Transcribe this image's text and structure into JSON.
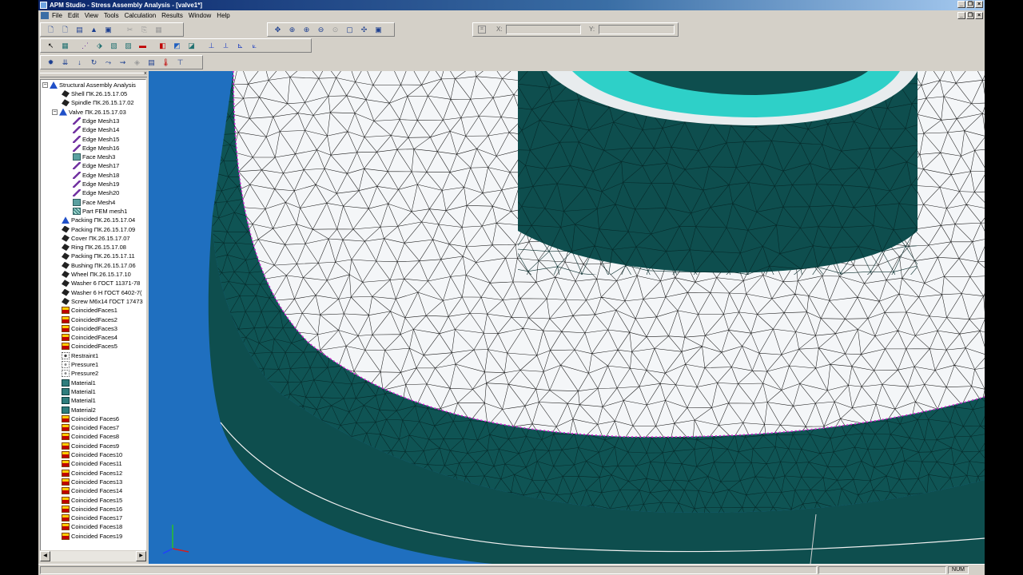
{
  "window": {
    "title": "APM Studio - Stress Assembly Analysis - [valve1*]"
  },
  "menu": {
    "items": [
      "File",
      "Edit",
      "View",
      "Tools",
      "Calculation",
      "Results",
      "Window",
      "Help"
    ]
  },
  "coords": {
    "x_label": "X:",
    "y_label": "Y:",
    "x_value": "",
    "y_value": ""
  },
  "tree": {
    "root": "Structural Assembly Analysis",
    "items": [
      {
        "label": "Shell ПК.26.15.17.05",
        "icon": "part-icon",
        "level": 1
      },
      {
        "label": "Spindle ПК.26.15.17.02",
        "icon": "part-icon",
        "level": 1
      },
      {
        "label": "Valve ПК.26.15.17.03",
        "icon": "assembly-icon",
        "level": 1,
        "expanded": true
      },
      {
        "label": "Edge Mesh13",
        "icon": "edge-mesh-icon",
        "level": 2
      },
      {
        "label": "Edge Mesh14",
        "icon": "edge-mesh-icon",
        "level": 2
      },
      {
        "label": "Edge Mesh15",
        "icon": "edge-mesh-icon",
        "level": 2
      },
      {
        "label": "Edge Mesh16",
        "icon": "edge-mesh-icon",
        "level": 2
      },
      {
        "label": "Face Mesh3",
        "icon": "face-mesh-icon",
        "level": 2
      },
      {
        "label": "Edge Mesh17",
        "icon": "edge-mesh-icon",
        "level": 2
      },
      {
        "label": "Edge Mesh18",
        "icon": "edge-mesh-icon",
        "level": 2
      },
      {
        "label": "Edge Mesh19",
        "icon": "edge-mesh-icon",
        "level": 2
      },
      {
        "label": "Edge Mesh20",
        "icon": "edge-mesh-icon",
        "level": 2
      },
      {
        "label": "Face Mesh4",
        "icon": "face-mesh-icon",
        "level": 2
      },
      {
        "label": "Part FEM mesh1",
        "icon": "fem-mesh-icon",
        "level": 2
      },
      {
        "label": "Packing ПК.26.15.17.04",
        "icon": "assembly-icon",
        "level": 1
      },
      {
        "label": "Packing ПК.26.15.17.09",
        "icon": "part-icon",
        "level": 1
      },
      {
        "label": "Cover ПК.26.15.17.07",
        "icon": "part-icon",
        "level": 1
      },
      {
        "label": "Ring ПК.26.15.17.08",
        "icon": "part-icon",
        "level": 1
      },
      {
        "label": "Packing ПК.26.15.17.11",
        "icon": "part-icon",
        "level": 1
      },
      {
        "label": "Bushing ПК.26.15.17.06",
        "icon": "part-icon",
        "level": 1
      },
      {
        "label": "Wheel ПК.26.15.17.10",
        "icon": "part-icon",
        "level": 1
      },
      {
        "label": "Washer 6 ГОСТ 11371-78",
        "icon": "part-icon",
        "level": 1
      },
      {
        "label": "Washer 6 Н ГОСТ 6402-7(",
        "icon": "part-icon",
        "level": 1
      },
      {
        "label": "Screw М6х14 ГОСТ 17473",
        "icon": "part-icon",
        "level": 1
      },
      {
        "label": "CoincidedFaces1",
        "icon": "coincided-faces-icon",
        "level": 1
      },
      {
        "label": "CoincidedFaces2",
        "icon": "coincided-faces-icon",
        "level": 1
      },
      {
        "label": "CoincidedFaces3",
        "icon": "coincided-faces-icon",
        "level": 1
      },
      {
        "label": "CoincidedFaces4",
        "icon": "coincided-faces-icon",
        "level": 1
      },
      {
        "label": "CoincidedFaces5",
        "icon": "coincided-faces-icon",
        "level": 1
      },
      {
        "label": "Restraint1",
        "icon": "restraint-icon",
        "level": 1
      },
      {
        "label": "Pressure1",
        "icon": "pressure-icon",
        "level": 1
      },
      {
        "label": "Pressure2",
        "icon": "pressure-icon",
        "level": 1
      },
      {
        "label": "Material1",
        "icon": "material-icon",
        "level": 1
      },
      {
        "label": "Material1",
        "icon": "material-icon",
        "level": 1
      },
      {
        "label": "Material1",
        "icon": "material-icon",
        "level": 1
      },
      {
        "label": "Material2",
        "icon": "material-icon",
        "level": 1
      },
      {
        "label": "Coincided Faces6",
        "icon": "coincided-faces-icon",
        "level": 1
      },
      {
        "label": "Coincided Faces7",
        "icon": "coincided-faces-icon",
        "level": 1
      },
      {
        "label": "Coincided Faces8",
        "icon": "coincided-faces-icon",
        "level": 1
      },
      {
        "label": "Coincided Faces9",
        "icon": "coincided-faces-icon",
        "level": 1
      },
      {
        "label": "Coincided Faces10",
        "icon": "coincided-faces-icon",
        "level": 1
      },
      {
        "label": "Coincided Faces11",
        "icon": "coincided-faces-icon",
        "level": 1
      },
      {
        "label": "Coincided Faces12",
        "icon": "coincided-faces-icon",
        "level": 1
      },
      {
        "label": "Coincided Faces13",
        "icon": "coincided-faces-icon",
        "level": 1
      },
      {
        "label": "Coincided Faces14",
        "icon": "coincided-faces-icon",
        "level": 1
      },
      {
        "label": "Coincided Faces15",
        "icon": "coincided-faces-icon",
        "level": 1
      },
      {
        "label": "Coincided Faces16",
        "icon": "coincided-faces-icon",
        "level": 1
      },
      {
        "label": "Coincided Faces17",
        "icon": "coincided-faces-icon",
        "level": 1
      },
      {
        "label": "Coincided Faces18",
        "icon": "coincided-faces-icon",
        "level": 1
      },
      {
        "label": "Coincided Faces19",
        "icon": "coincided-faces-icon",
        "level": 1
      }
    ]
  },
  "toolbar": {
    "row1": [
      "new-file-icon",
      "new-template-icon",
      "open-icon",
      "open-model-icon",
      "save-icon",
      "cut-icon",
      "copy-icon",
      "paste-icon"
    ],
    "view": [
      "pan-icon",
      "zoom-icon",
      "zoom-in-icon",
      "zoom-out-icon",
      "zoom-window-icon",
      "zoom-fit-icon",
      "rotate-icon",
      "view-all-icon"
    ],
    "row2": [
      "select-icon",
      "mesh-part-icon",
      "edge-mesh-icon",
      "mesh-face-icon",
      "part-mesh-icon",
      "face-mesh-icon",
      "coincided-faces-icon",
      "solid-icon",
      "shell-icon",
      "cut-section-icon",
      "axes-icon",
      "axes-xy-icon",
      "axes-xz-icon"
    ],
    "row3": [
      "restraint-icon",
      "pressure-icon",
      "force-icon",
      "moment-icon",
      "distributed-load-icon",
      "gravity-icon",
      "calculation-icon",
      "results-icon"
    ]
  },
  "status": {
    "num": "NUM"
  },
  "colors": {
    "viewport_blue": "#1f6fbf",
    "mesh_face": "#f4f6f8",
    "mesh_side": "#0e4e4e",
    "mesh_highlight": "#d020d0",
    "top_face": "#2ed0c8"
  }
}
